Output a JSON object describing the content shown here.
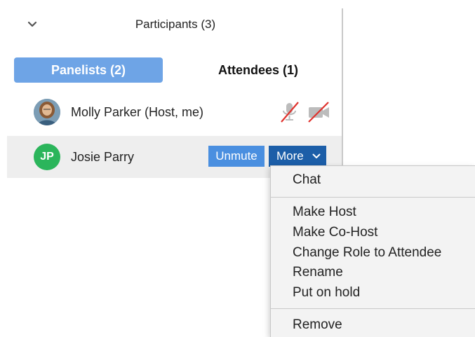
{
  "panel": {
    "title": "Participants (3)",
    "tabs": [
      {
        "label": "Panelists (2)",
        "active": true
      },
      {
        "label": "Attendees (1)",
        "active": false
      }
    ]
  },
  "participants": [
    {
      "name": "Molly Parker (Host, me)",
      "avatar": "photo",
      "mic": "muted",
      "video": "off"
    },
    {
      "name": "Josie Parry",
      "avatar_initials": "JP",
      "avatar_color": "#2bb55b"
    }
  ],
  "row_actions": {
    "unmute_label": "Unmute",
    "more_label": "More"
  },
  "menu": {
    "items": [
      "Chat",
      "Make Host",
      "Make Co-Host",
      "Change Role to Attendee",
      "Rename",
      "Put on hold",
      "Remove"
    ]
  },
  "colors": {
    "active_tab": "#6ea4e6",
    "unmute_button": "#4a8fe0",
    "more_button": "#1c5ea8",
    "muted_slash": "#e0322d",
    "initials_avatar": "#2bb55b",
    "selected_row": "#eeeeee"
  },
  "icons": [
    "chevron-down-icon",
    "mic-muted-icon",
    "video-off-icon",
    "chevron-down-small-icon"
  ]
}
